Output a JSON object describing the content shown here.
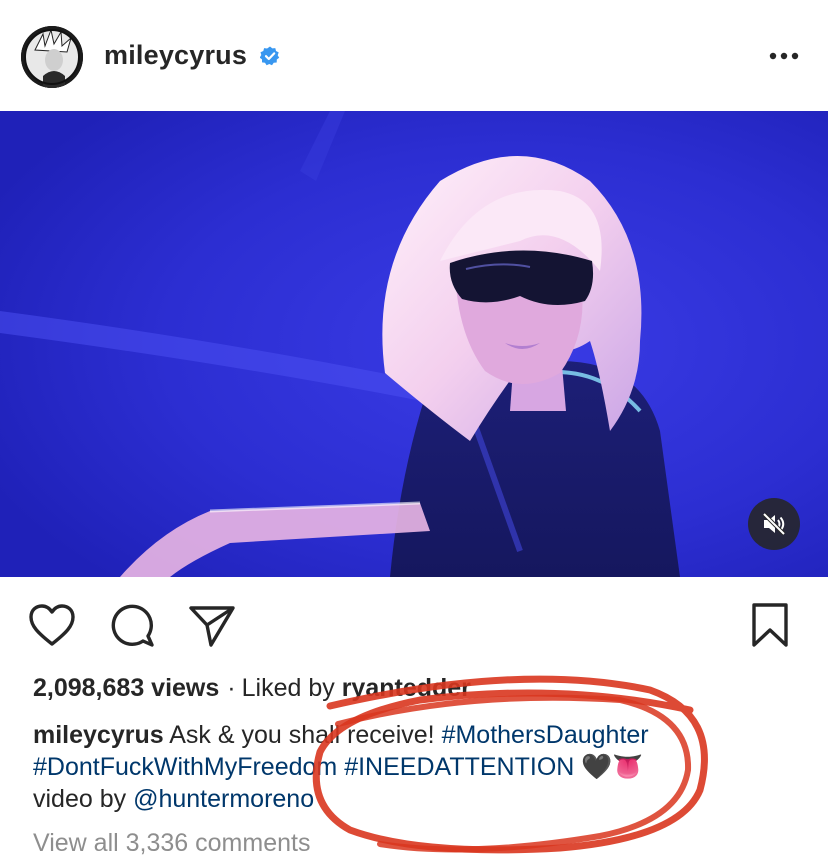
{
  "header": {
    "username": "mileycyrus",
    "verified_icon": "verified-badge-icon",
    "more_icon": "more-options-icon"
  },
  "media": {
    "type": "video",
    "mute_icon": "speaker-muted-icon",
    "colors": {
      "background": "#2d2fd0",
      "hair": "#f2dff0"
    }
  },
  "actions": {
    "like_icon": "heart-icon",
    "comment_icon": "comment-bubble-icon",
    "share_icon": "paper-plane-icon",
    "save_icon": "bookmark-icon"
  },
  "stats": {
    "views": "2,098,683 views",
    "separator": "·",
    "liked_by_prefix": "Liked by",
    "liked_by_user": "ryantedder"
  },
  "caption": {
    "username": "mileycyrus",
    "text": "Ask & you shall receive!",
    "tag1": "#MothersDaughter",
    "tag2": "#DontFuckWithMyFreedom",
    "tag3": "#INEEDATTENTION",
    "emojis": "🖤👅",
    "credit_prefix": "video by",
    "credit_user": "@huntermoreno"
  },
  "comments": {
    "view_all": "View all 3,336 comments"
  },
  "colors": {
    "text": "#262626",
    "hashtag": "#00376b",
    "muted": "#8e8e8e",
    "verified": "#3897f0",
    "annotation": "#d9361f"
  }
}
